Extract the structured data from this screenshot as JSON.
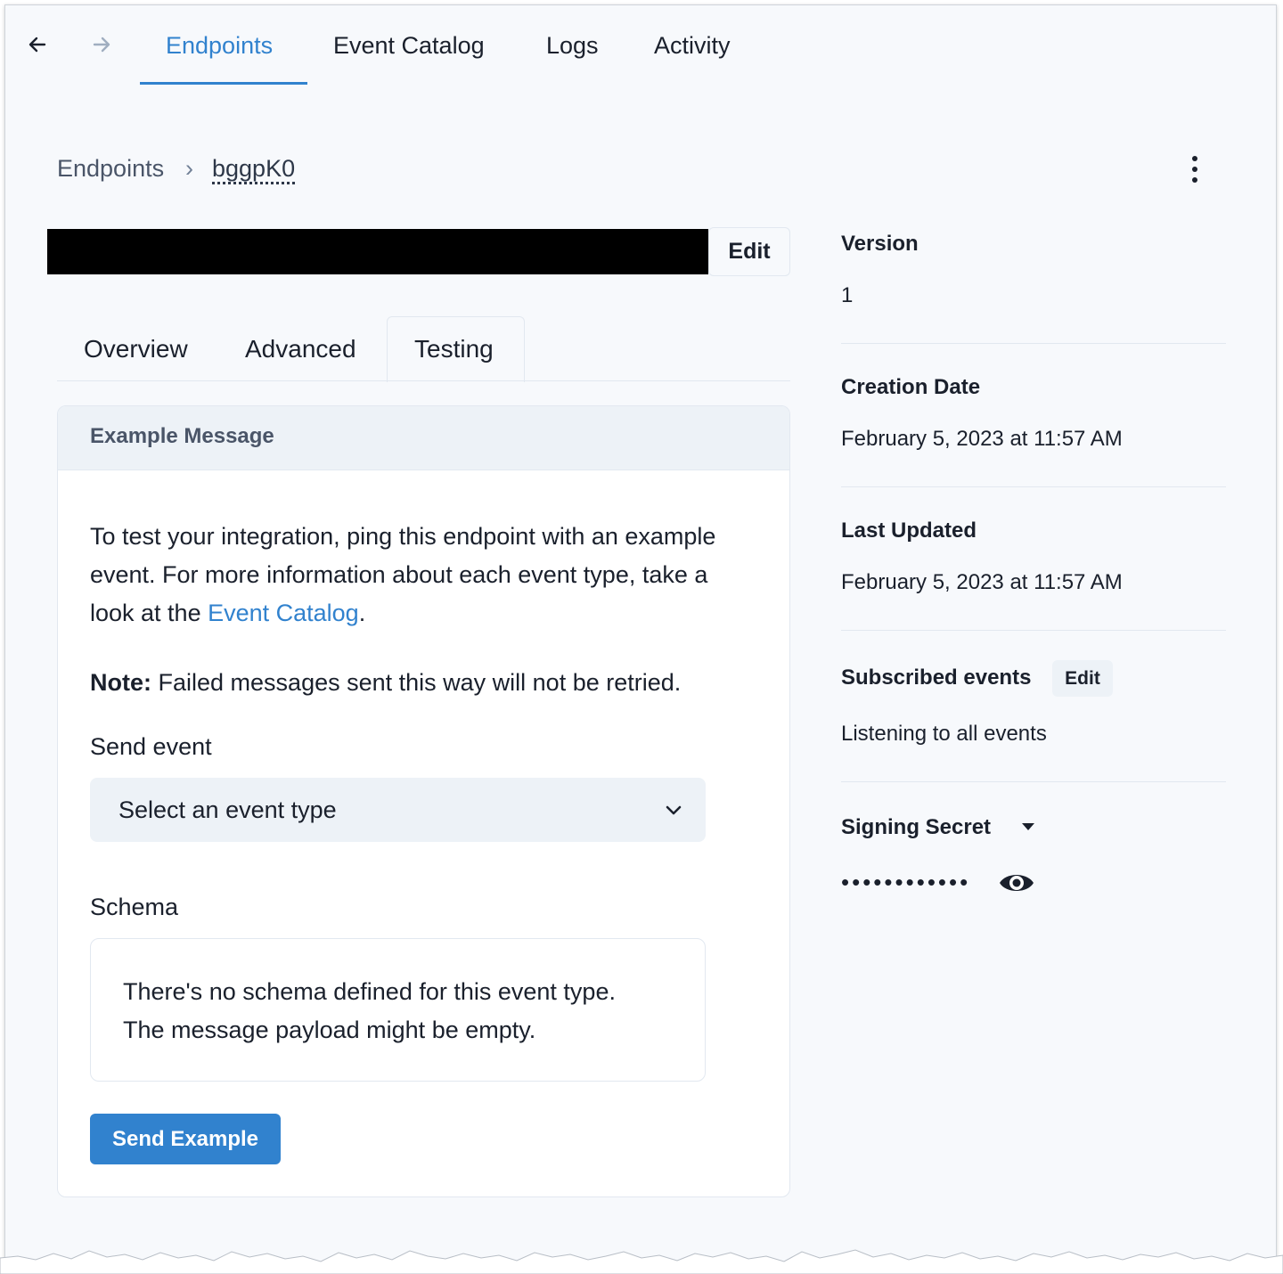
{
  "nav": {
    "back_icon": "arrow-left-icon",
    "forward_icon": "arrow-right-icon",
    "tabs": [
      "Endpoints",
      "Event Catalog",
      "Logs",
      "Activity"
    ],
    "active_tab": "Endpoints"
  },
  "breadcrumb": {
    "root": "Endpoints",
    "separator": "›",
    "current": "bggpK0"
  },
  "header": {
    "edit_label": "Edit",
    "more_icon": "vertical-ellipsis-icon"
  },
  "subtabs": {
    "items": [
      "Overview",
      "Advanced",
      "Testing"
    ],
    "active": "Testing"
  },
  "card": {
    "title": "Example Message",
    "intro_before_link": "To test your integration, ping this endpoint with an example event. For more information about each event type, take a look at the ",
    "intro_link": "Event Catalog",
    "intro_after_link": ".",
    "note_label": "Note:",
    "note_text": " Failed messages sent this way will not be retried.",
    "send_event_label": "Send event",
    "select_placeholder": "Select an event type",
    "schema_label": "Schema",
    "schema_line1": "There's no schema defined for this event type.",
    "schema_line2": "The message payload might be empty.",
    "send_button": "Send Example"
  },
  "details": {
    "version_label": "Version",
    "version_value": "1",
    "creation_label": "Creation Date",
    "creation_value": "February 5, 2023 at 11:57 AM",
    "updated_label": "Last Updated",
    "updated_value": "February 5, 2023 at 11:57 AM",
    "subscribed_label": "Subscribed events",
    "subscribed_edit": "Edit",
    "subscribed_value": "Listening to all events",
    "secret_label": "Signing Secret",
    "secret_masked": "••••••••••••",
    "secret_toggle_icon": "eye-icon"
  },
  "colors": {
    "accent": "#3182ce",
    "background": "#f7f9fc",
    "card_header": "#edf2f7"
  }
}
